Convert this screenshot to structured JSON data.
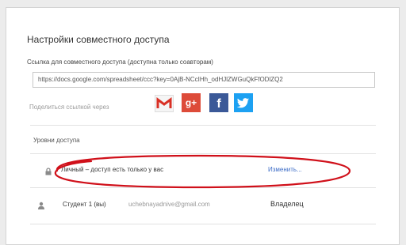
{
  "dialog": {
    "title": "Настройки совместного доступа",
    "link_label": "Ссылка для совместного доступа (доступна только соавторам)",
    "link_value": "https://docs.google.com/spreadsheet/ccc?key=0AjB-NCcIHh_odHJlZWGuQkFfODlZQ2",
    "share_via_label": "Поделиться ссылкой через",
    "share_icons": [
      {
        "name": "gmail-icon",
        "glyph": "M",
        "color": "#d93025"
      },
      {
        "name": "google-plus-icon",
        "glyph": "g+",
        "color": "#dd4b39"
      },
      {
        "name": "facebook-icon",
        "glyph": "f",
        "color": "#3b5998"
      },
      {
        "name": "twitter-icon",
        "glyph": "t",
        "color": "#1da1f2"
      }
    ],
    "access_levels_label": "Уровни доступа",
    "access_rows": [
      {
        "icon": "lock-icon",
        "text": "Личный – доступ есть только у вас",
        "action": "Изменить..."
      },
      {
        "icon": "person-icon",
        "text": "Студент 1 (вы)",
        "email": "uchebnayadnive@gmail.com",
        "role": "Владелец"
      }
    ]
  },
  "colors": {
    "accent_link": "#3b6bc6",
    "annotation": "#d0101a"
  }
}
